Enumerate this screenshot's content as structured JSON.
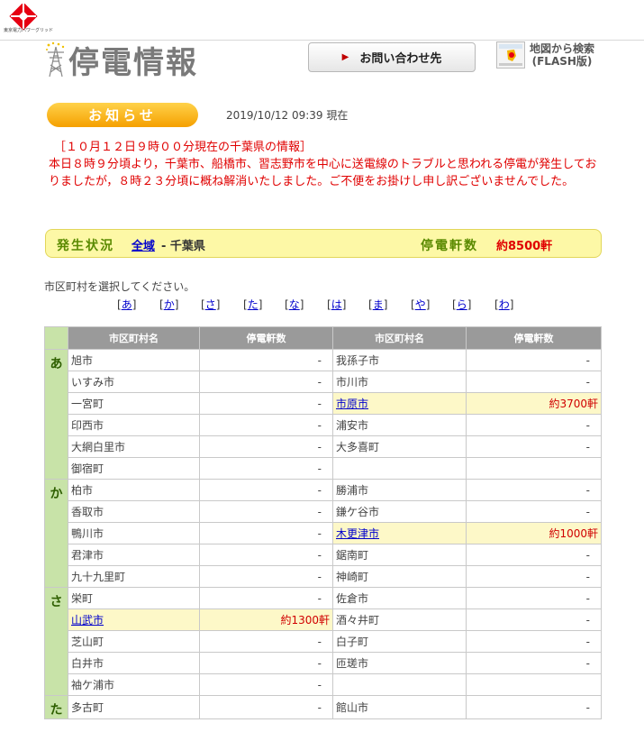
{
  "header": {
    "logo_text": "東京電力パワーグリッド",
    "page_title": "停電情報",
    "contact_button": "お問い合わせ先",
    "map_search_line1": "地図から検索",
    "map_search_line2": "(FLASH版)"
  },
  "notice": {
    "badge": "お知らせ",
    "timestamp": "2019/10/12 09:39 現在",
    "headline": "［１０月１２日９時００分現在の千葉県の情報］",
    "body": "本日８時９分頃より，千葉市、船橋市、習志野市を中心に送電線のトラブルと思われる停電が発生しておりましたが，８時２３分頃に概ね解消いたしました。ご不便をお掛けし申し訳ございませんでした。"
  },
  "status": {
    "label": "発生状況",
    "area_link": "全域",
    "prefecture": " - 千葉県",
    "count_label": "停電軒数",
    "count": "約8500軒"
  },
  "select_prompt": "市区町村を選択してください。",
  "kana_index": [
    "あ",
    "か",
    "さ",
    "た",
    "な",
    "は",
    "ま",
    "や",
    "ら",
    "わ"
  ],
  "table": {
    "col_city": "市区町村名",
    "col_count": "停電軒数",
    "groups": [
      {
        "kana": "あ",
        "rows": [
          [
            {
              "name": "旭市",
              "count": "-"
            },
            {
              "name": "我孫子市",
              "count": "-"
            }
          ],
          [
            {
              "name": "いすみ市",
              "count": "-"
            },
            {
              "name": "市川市",
              "count": "-"
            }
          ],
          [
            {
              "name": "一宮町",
              "count": "-"
            },
            {
              "name": "市原市",
              "count": "約3700軒",
              "link": true
            }
          ],
          [
            {
              "name": "印西市",
              "count": "-"
            },
            {
              "name": "浦安市",
              "count": "-"
            }
          ],
          [
            {
              "name": "大網白里市",
              "count": "-"
            },
            {
              "name": "大多喜町",
              "count": "-"
            }
          ],
          [
            {
              "name": "御宿町",
              "count": "-"
            },
            null
          ]
        ]
      },
      {
        "kana": "か",
        "rows": [
          [
            {
              "name": "柏市",
              "count": "-"
            },
            {
              "name": "勝浦市",
              "count": "-"
            }
          ],
          [
            {
              "name": "香取市",
              "count": "-"
            },
            {
              "name": "鎌ケ谷市",
              "count": "-"
            }
          ],
          [
            {
              "name": "鴨川市",
              "count": "-"
            },
            {
              "name": "木更津市",
              "count": "約1000軒",
              "link": true
            }
          ],
          [
            {
              "name": "君津市",
              "count": "-"
            },
            {
              "name": "鋸南町",
              "count": "-"
            }
          ],
          [
            {
              "name": "九十九里町",
              "count": "-"
            },
            {
              "name": "神崎町",
              "count": "-"
            }
          ]
        ]
      },
      {
        "kana": "さ",
        "rows": [
          [
            {
              "name": "栄町",
              "count": "-"
            },
            {
              "name": "佐倉市",
              "count": "-"
            }
          ],
          [
            {
              "name": "山武市",
              "count": "約1300軒",
              "link": true
            },
            {
              "name": "酒々井町",
              "count": "-"
            }
          ],
          [
            {
              "name": "芝山町",
              "count": "-"
            },
            {
              "name": "白子町",
              "count": "-"
            }
          ],
          [
            {
              "name": "白井市",
              "count": "-"
            },
            {
              "name": "匝瑳市",
              "count": "-"
            }
          ],
          [
            {
              "name": "袖ケ浦市",
              "count": "-"
            },
            null
          ]
        ]
      },
      {
        "kana": "た",
        "rows": [
          [
            {
              "name": "多古町",
              "count": "-"
            },
            {
              "name": "館山市",
              "count": "-"
            }
          ]
        ]
      }
    ]
  }
}
